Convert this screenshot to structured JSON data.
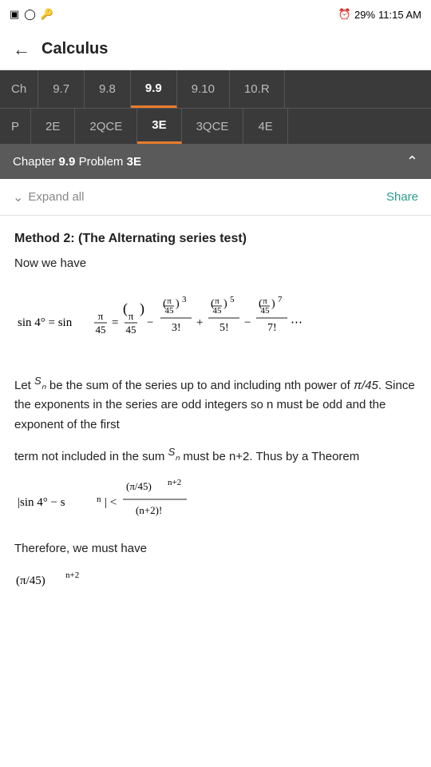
{
  "statusBar": {
    "icons_left": [
      "sim-icon",
      "circle-icon",
      "key-icon"
    ],
    "battery": "29%",
    "time": "11:15 AM",
    "signal": "29%"
  },
  "topNav": {
    "back_label": "←",
    "title": "Calculus"
  },
  "chapterTabs": {
    "label": "Ch",
    "tabs": [
      "9.7",
      "9.8",
      "9.9",
      "9.10",
      "10.R"
    ],
    "active": "9.9"
  },
  "problemTabs": {
    "label": "P",
    "tabs": [
      "2E",
      "2QCE",
      "3E",
      "3QCE",
      "4E"
    ],
    "active": "3E"
  },
  "sectionHeader": {
    "prefix": "Chapter",
    "chapter": "9.9",
    "mid": "Problem",
    "problem": "3E"
  },
  "toolbar": {
    "expand_all": "Expand all",
    "share": "Share"
  },
  "content": {
    "method_title": "Method 2: (The Alternating series test)",
    "now_we_have": "Now we have",
    "body1": "Let ",
    "sn_label": "Sₙ",
    "body1b": " be the sum of the series up to and including nth power of ",
    "pi_over_45": "π/45",
    "body1c": ". Since the exponents in the series are odd integers so n must be odd and the exponent of the first",
    "body2": "term not included in the sum ",
    "sn_label2": "Sₙ",
    "body2b": " must be n+2. Thus by a Theorem",
    "inequality": "|sin 4° − sₙ| < (π/45)ⁿ⁺²/(n+2)!",
    "therefore": "Therefore, we must have",
    "pi_expr": "(π/45)ⁿ⁺²"
  }
}
